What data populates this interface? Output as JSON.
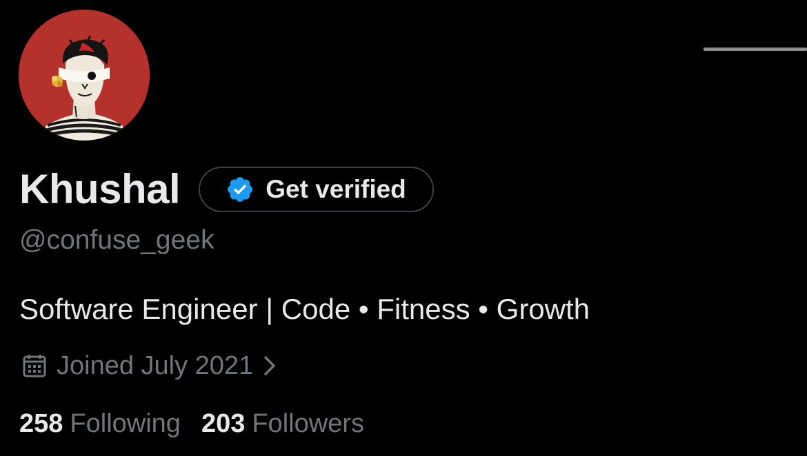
{
  "profile": {
    "display_name": "Khushal",
    "handle": "@confuse_geek",
    "bio": "Software Engineer | Code • Fitness • Growth",
    "joined": "Joined July 2021",
    "avatar_bg": "#b5312b"
  },
  "verify_button": {
    "label": "Get verified",
    "badge_color": "#1d9bf0",
    "icon": "verified-badge-icon"
  },
  "stats": {
    "following_count": "258",
    "following_label": "Following",
    "followers_count": "203",
    "followers_label": "Followers"
  },
  "icons": {
    "calendar": "calendar-icon",
    "chevron": "chevron-right-icon"
  },
  "colors": {
    "background": "#000000",
    "primary_text": "#e7e9ea",
    "secondary_text": "#71767b",
    "border": "#3d4145"
  }
}
